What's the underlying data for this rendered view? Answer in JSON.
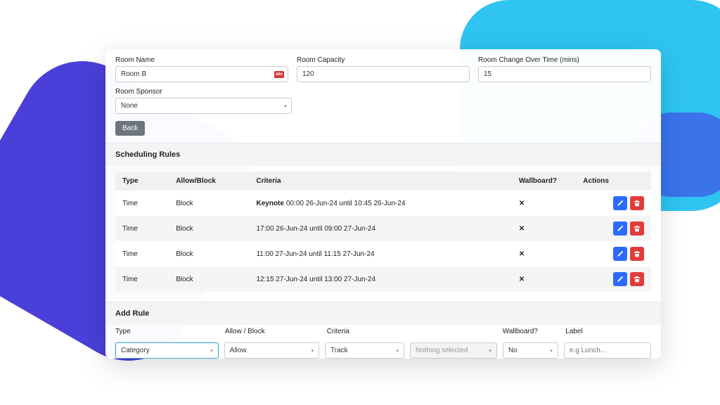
{
  "form": {
    "room_name": {
      "label": "Room Name",
      "value": "Room B"
    },
    "room_capacity": {
      "label": "Room Capacity",
      "value": "120"
    },
    "room_change_over": {
      "label": "Room Change Over Time (mins)",
      "value": "15"
    },
    "room_sponsor": {
      "label": "Room Sponsor",
      "value": "None"
    },
    "back_btn": "Back"
  },
  "rules_panel": {
    "title": "Scheduling Rules",
    "headers": {
      "type": "Type",
      "allow_block": "Allow/Block",
      "criteria": "Criteria",
      "wallboard": "Wallboard?",
      "actions": "Actions"
    },
    "rows": [
      {
        "type": "Time",
        "allow_block": "Block",
        "criteria_tag": "Keynote",
        "criteria": "00:00 26-Jun-24 until 10:45 26-Jun-24",
        "wallboard": "✕"
      },
      {
        "type": "Time",
        "allow_block": "Block",
        "criteria_tag": "",
        "criteria": "17:00 26-Jun-24 until 09:00 27-Jun-24",
        "wallboard": "✕"
      },
      {
        "type": "Time",
        "allow_block": "Block",
        "criteria_tag": "",
        "criteria": "11:00 27-Jun-24 until 11:15 27-Jun-24",
        "wallboard": "✕"
      },
      {
        "type": "Time",
        "allow_block": "Block",
        "criteria_tag": "",
        "criteria": "12:15 27-Jun-24 until 13:00 27-Jun-24",
        "wallboard": "✕"
      }
    ]
  },
  "add_rule": {
    "title": "Add Rule",
    "headers": {
      "type": "Type",
      "allow_block": "Allow / Block",
      "criteria": "Criteria",
      "wallboard": "Wallboard?",
      "label": "Label"
    },
    "type_value": "Category",
    "allow_value": "Allow",
    "criteria1_value": "Track",
    "criteria2_value": "Nothing selected",
    "wallboard_value": "No",
    "label_placeholder": "e.g Lunch..."
  }
}
